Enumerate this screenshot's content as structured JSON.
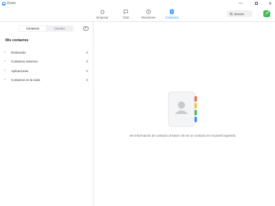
{
  "window": {
    "title": "Zoom",
    "minimize_glyph": "—",
    "close_glyph": "✕"
  },
  "nav": {
    "items": [
      {
        "label": "Empezar",
        "icon": "home-icon"
      },
      {
        "label": "Chat",
        "icon": "chat-icon"
      },
      {
        "label": "Reuniones",
        "icon": "clock-icon"
      },
      {
        "label": "Contactos",
        "icon": "contacts-icon",
        "active": true
      }
    ]
  },
  "search": {
    "label": "Buscar"
  },
  "sidebar": {
    "tabs": [
      "Contactos",
      "Canales"
    ],
    "add_glyph": "+",
    "section_title": "Mis contactos",
    "chevron": "›",
    "groups": [
      {
        "label": "Destacado",
        "count": "0"
      },
      {
        "label": "Contactos externos",
        "count": "0"
      },
      {
        "label": "Aplicaciones",
        "count": "0"
      },
      {
        "label": "Contactos en la nube",
        "count": "0"
      }
    ]
  },
  "main": {
    "empty_message": "Ver información de contacto al hacer clic en un contacto en el panel izquierdo."
  },
  "colors": {
    "accent": "#2D8CFF",
    "avatar": "#3fbd5b",
    "tab_red": "#f06543",
    "tab_yellow": "#f5c12e",
    "tab_green": "#3fbd5b",
    "tab_blue": "#2D8CFF"
  }
}
